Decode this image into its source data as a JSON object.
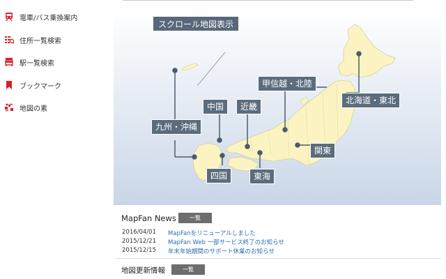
{
  "sidebar": {
    "items": [
      {
        "label": "電車/バス乗換案内",
        "icon": "train-icon"
      },
      {
        "label": "住所一覧検索",
        "icon": "address-list-icon"
      },
      {
        "label": "駅一覧検索",
        "icon": "station-icon"
      },
      {
        "label": "ブックマーク",
        "icon": "bookmark-icon"
      },
      {
        "label": "地図の素",
        "icon": "map-elements-icon"
      }
    ]
  },
  "map": {
    "scroll_label": "スクロール地図表示",
    "regions": {
      "hokkaido_tohoku": "北海道・東北",
      "koshinetsu_hokuriku": "甲信越・北陸",
      "chugoku": "中国",
      "kinki": "近畿",
      "kyushu_okinawa": "九州・沖縄",
      "kanto": "関東",
      "shikoku": "四国",
      "tokai": "東海"
    }
  },
  "news": {
    "title": "MapFan News",
    "list_button": "一覧",
    "items": [
      {
        "date": "2016/04/01",
        "text": "MapFanをリニューアルしました"
      },
      {
        "date": "2015/12/21",
        "text": "MapFan Web 一部サービス終了のお知らせ"
      },
      {
        "date": "2015/12/15",
        "text": "年末年始期間のサポート休業のお知らせ"
      }
    ]
  },
  "map_update": {
    "title": "地図更新情報",
    "list_button": "一覧"
  },
  "colors": {
    "accent": "#d2232a",
    "land": "#fbf3c2",
    "label_bg": "#5b6c7c",
    "link": "#2b6fb5",
    "button": "#6d6d6d"
  }
}
